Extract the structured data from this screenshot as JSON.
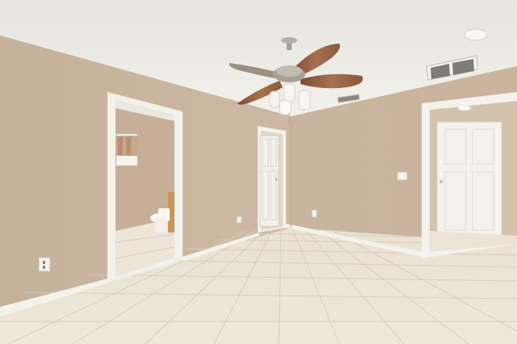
{
  "scene": {
    "kind": "photo",
    "description_free": true
  },
  "palette": {
    "ceiling": "#ecebe6",
    "wall_left": "#c9b49d",
    "wall_right": "#cdb9a3",
    "wall_shadow": "#bda891",
    "trim": "#f5f3ee",
    "floor": "#ece4d5",
    "floor_grout": "#d4cab9",
    "door": "#f2f1ec",
    "blade_wood": "#9a6a4c",
    "fan_metal": "#a9a39a",
    "glass": "#f7f5ef"
  }
}
